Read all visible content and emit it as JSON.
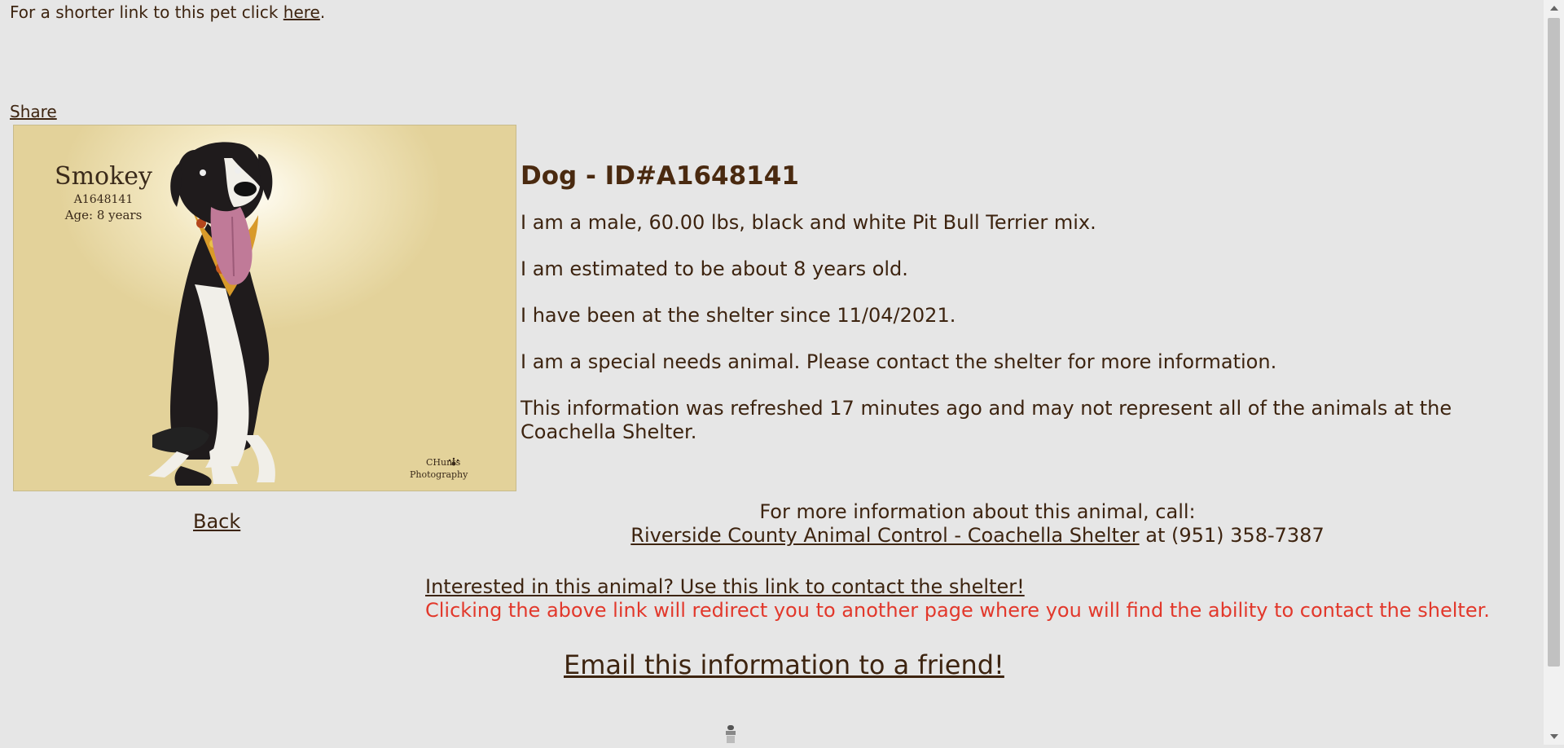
{
  "header": {
    "shortlink_prefix": "For a shorter link to this pet click ",
    "shortlink_link": "here",
    "shortlink_suffix": ".",
    "share_label": "Share"
  },
  "photo": {
    "name": "Smokey",
    "id": "A1648141",
    "age": "Age: 8 years",
    "credit_line1": "CHunts",
    "credit_line2": "Photography"
  },
  "animal": {
    "title": "Dog - ID#A1648141",
    "description": "I am a male, 60.00 lbs, black and white Pit Bull Terrier mix.",
    "age_text": "I am estimated to be about 8 years old.",
    "shelter_since": "I have been at the shelter since 11/04/2021.",
    "special_needs": "I am a special needs animal. Please contact the shelter for more information.",
    "refresh_note": "This information was refreshed 17 minutes ago and may not represent all of the animals at the Coachella Shelter."
  },
  "nav": {
    "back_label": "Back"
  },
  "contact": {
    "intro": "For more information about this animal, call:",
    "shelter_link": "Riverside County Animal Control - Coachella Shelter",
    "phone_text": " at (951) 358-7387"
  },
  "interest": {
    "link_text": "Interested in this animal? Use this link to contact the shelter!",
    "warning": "Clicking the above link will redirect you to another page where you will find the ability to contact the shelter."
  },
  "email": {
    "label": "Email this information to a friend!"
  },
  "colors": {
    "background": "#e6e6e6",
    "text": "#3d2410",
    "warning": "#e2382b",
    "photo_bg": "#e3d29a"
  }
}
